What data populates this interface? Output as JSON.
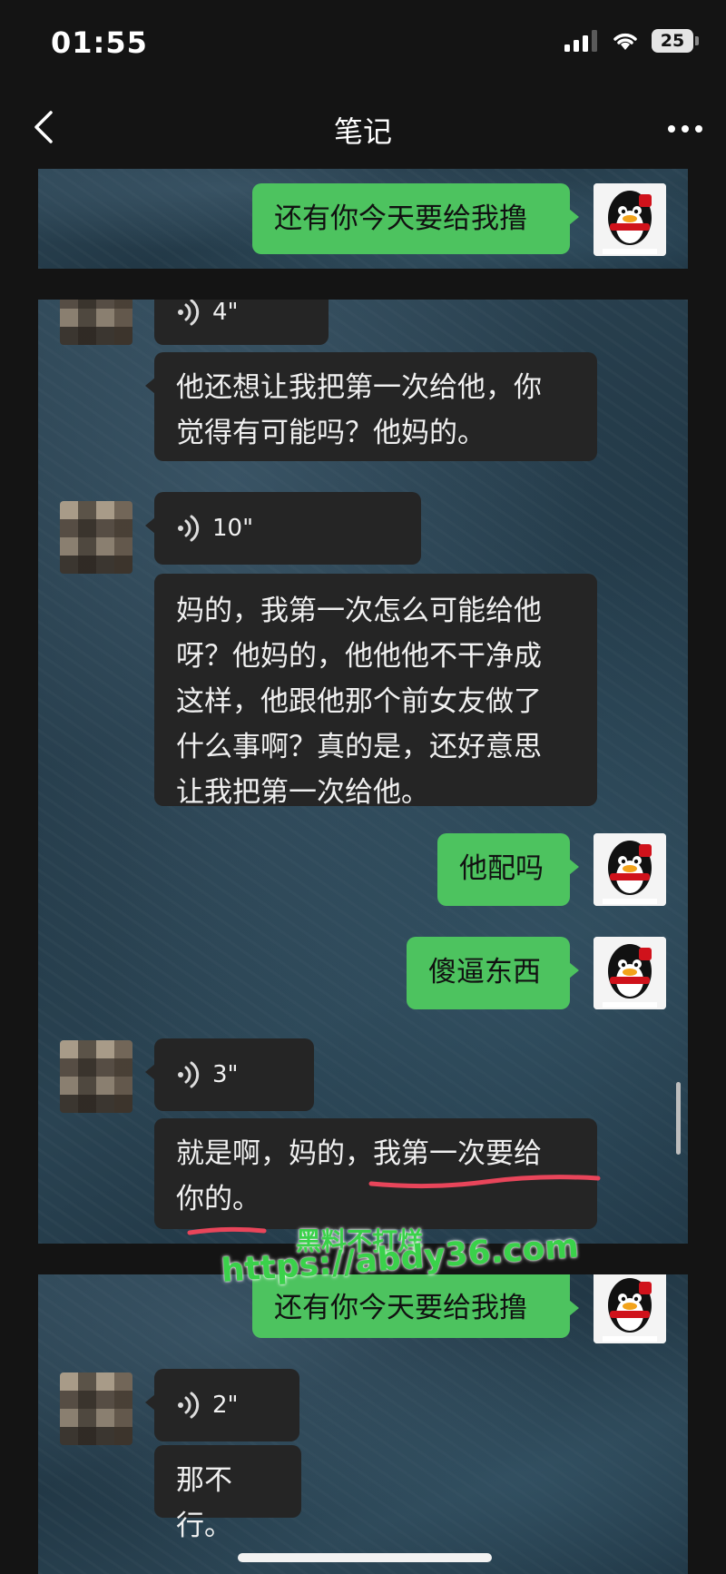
{
  "status": {
    "time": "01:55",
    "battery": "25"
  },
  "nav": {
    "title": "笔记"
  },
  "messages": {
    "m1": "还有你今天要给我撸",
    "v1": "4\"",
    "m2_line1": "他还想让我把第一次给他，你",
    "m2_line2": "觉得有可能吗？他妈的。",
    "v2": "10\"",
    "m3_line1": "妈的，我第一次怎么可能给他",
    "m3_line2": "呀？他妈的，他他他不干净成",
    "m3_line3": "这样，他跟他那个前女友做了",
    "m3_line4": "什么事啊？真的是，还好意思",
    "m3_line5": "让我把第一次给他。",
    "m4": "他配吗",
    "m5": "傻逼东西",
    "v3": "3\"",
    "m6_line1": "就是啊，妈的，我第一次要给",
    "m6_line2": "你的。",
    "m7": "还有你今天要给我撸",
    "v4": "2\"",
    "m8": "那不行。"
  },
  "watermark": {
    "line1": "黑料不打烊",
    "line2": "https://abdy36.com"
  },
  "colors": {
    "green_bubble": "#4dc35f",
    "dark_bubble": "#252525",
    "watermark": "#3ad14a"
  },
  "icons": [
    "signal-icon",
    "wifi-icon",
    "battery-icon",
    "back-chevron-icon",
    "more-icon",
    "voice-wave-icon"
  ]
}
